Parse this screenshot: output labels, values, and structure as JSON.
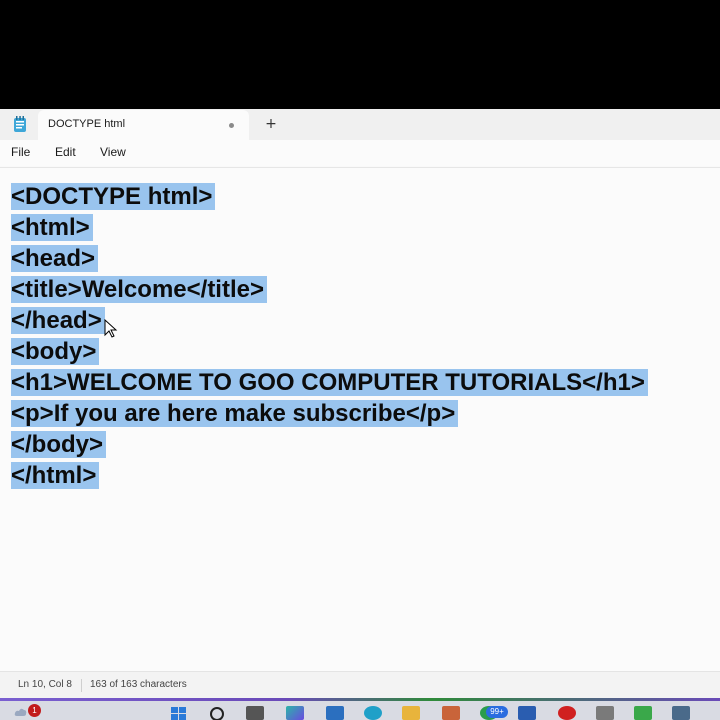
{
  "app": {
    "tab_title": "DOCTYPE html",
    "new_tab_symbol": "+",
    "icon": "notepad-icon"
  },
  "menu": {
    "file": "File",
    "edit": "Edit",
    "view": "View"
  },
  "editor": {
    "lines": [
      "<DOCTYPE html>",
      "<html>",
      "<head>",
      "<title>Welcome</title>",
      "</head>",
      "<body>",
      "<h1>WELCOME TO GOO COMPUTER TUTORIALS</h1>",
      "<p>If you are here make subscribe</p>",
      "</body>",
      "</html>"
    ]
  },
  "status": {
    "position": "Ln 10, Col 8",
    "characters": "163 of 163 characters"
  },
  "taskbar": {
    "notification_badge": "1",
    "app_badge": "99+"
  },
  "colors": {
    "selection": "#99c4ee",
    "background": "#fbfbfb"
  }
}
